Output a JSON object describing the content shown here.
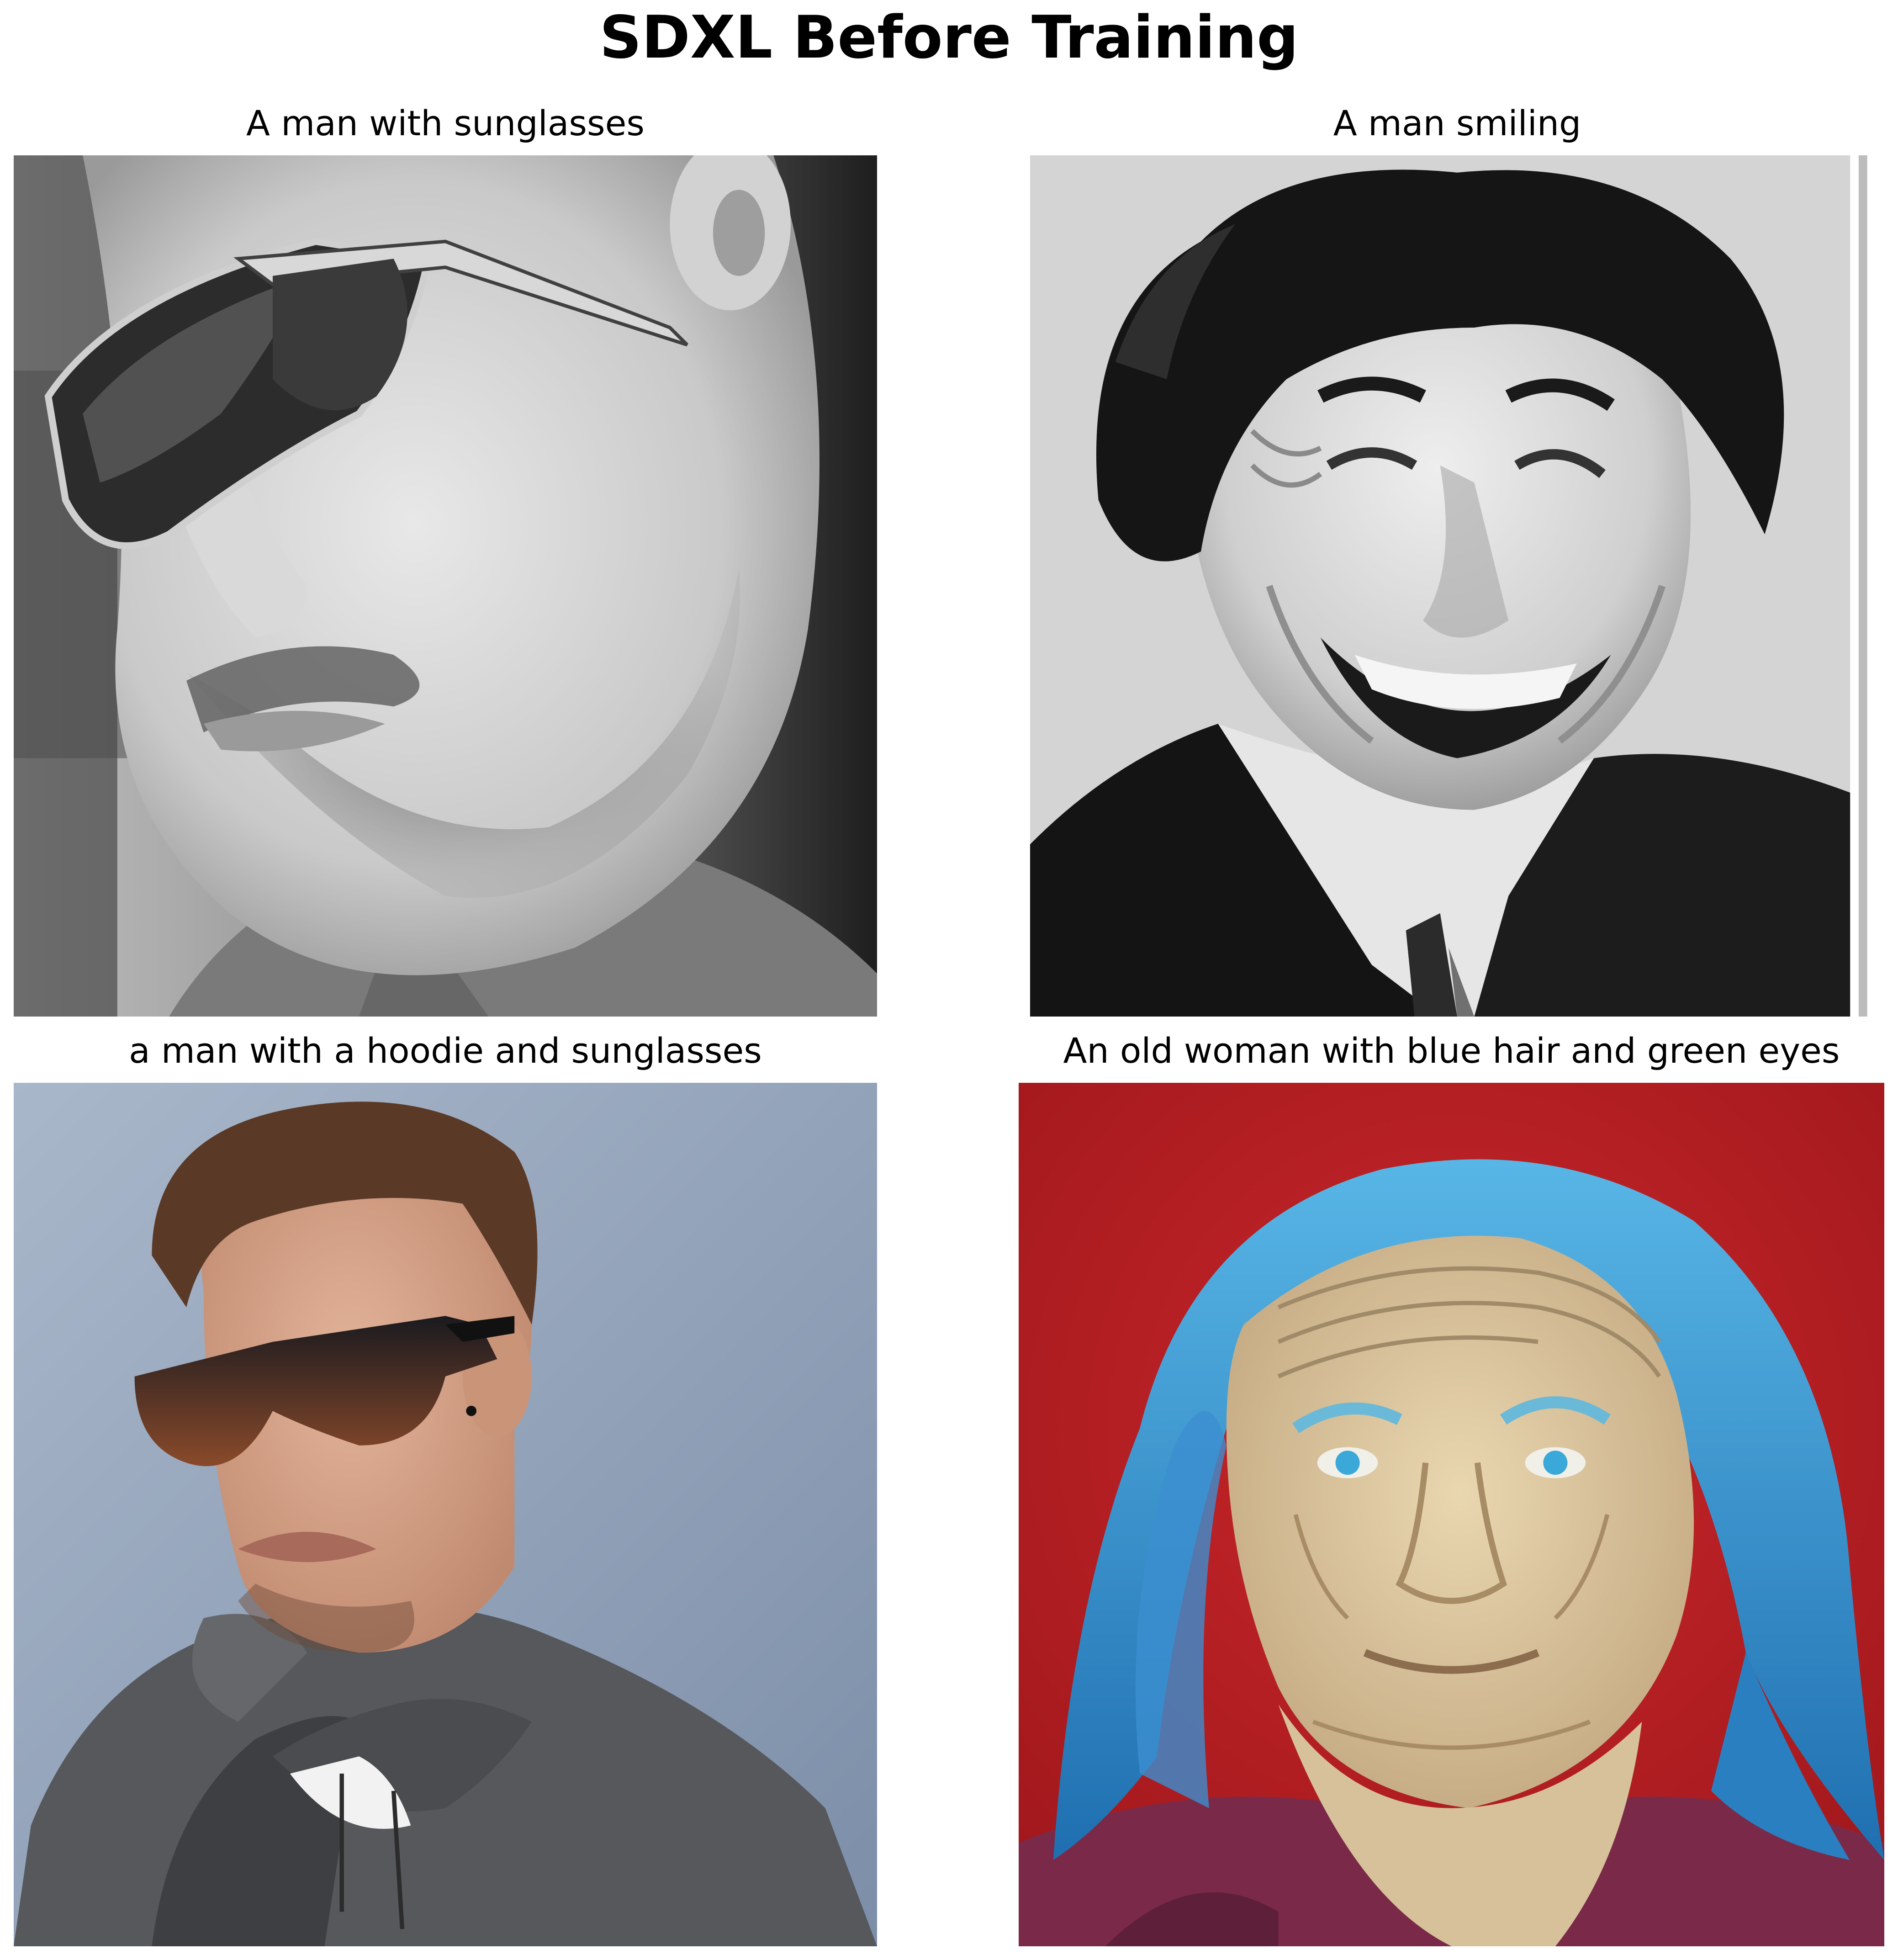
{
  "figure": {
    "title": "SDXL Before Training"
  },
  "panels": [
    {
      "caption": "A man with sunglasses",
      "image": {
        "kind": "photo",
        "palette": "grayscale",
        "depicts": "man-with-sunglasses"
      }
    },
    {
      "caption": "A man smiling",
      "image": {
        "kind": "photo",
        "palette": "grayscale",
        "depicts": "man-smiling"
      }
    },
    {
      "caption": "a man with a hoodie and sunglasses",
      "image": {
        "kind": "photo",
        "palette": "color",
        "depicts": "man-in-hoodie-with-sunglasses"
      }
    },
    {
      "caption": "An old woman with blue hair and green eyes",
      "image": {
        "kind": "painting",
        "palette": "color",
        "depicts": "old-woman-blue-hair"
      }
    }
  ],
  "colors": {
    "background": "#ffffff",
    "text": "#000000",
    "panel4_background_red": "#b81f23",
    "panel4_hair_blue": "#2e8fcf",
    "panel3_background_blue": "#8ea1bb",
    "panel3_hoodie_gray": "#55575a"
  }
}
